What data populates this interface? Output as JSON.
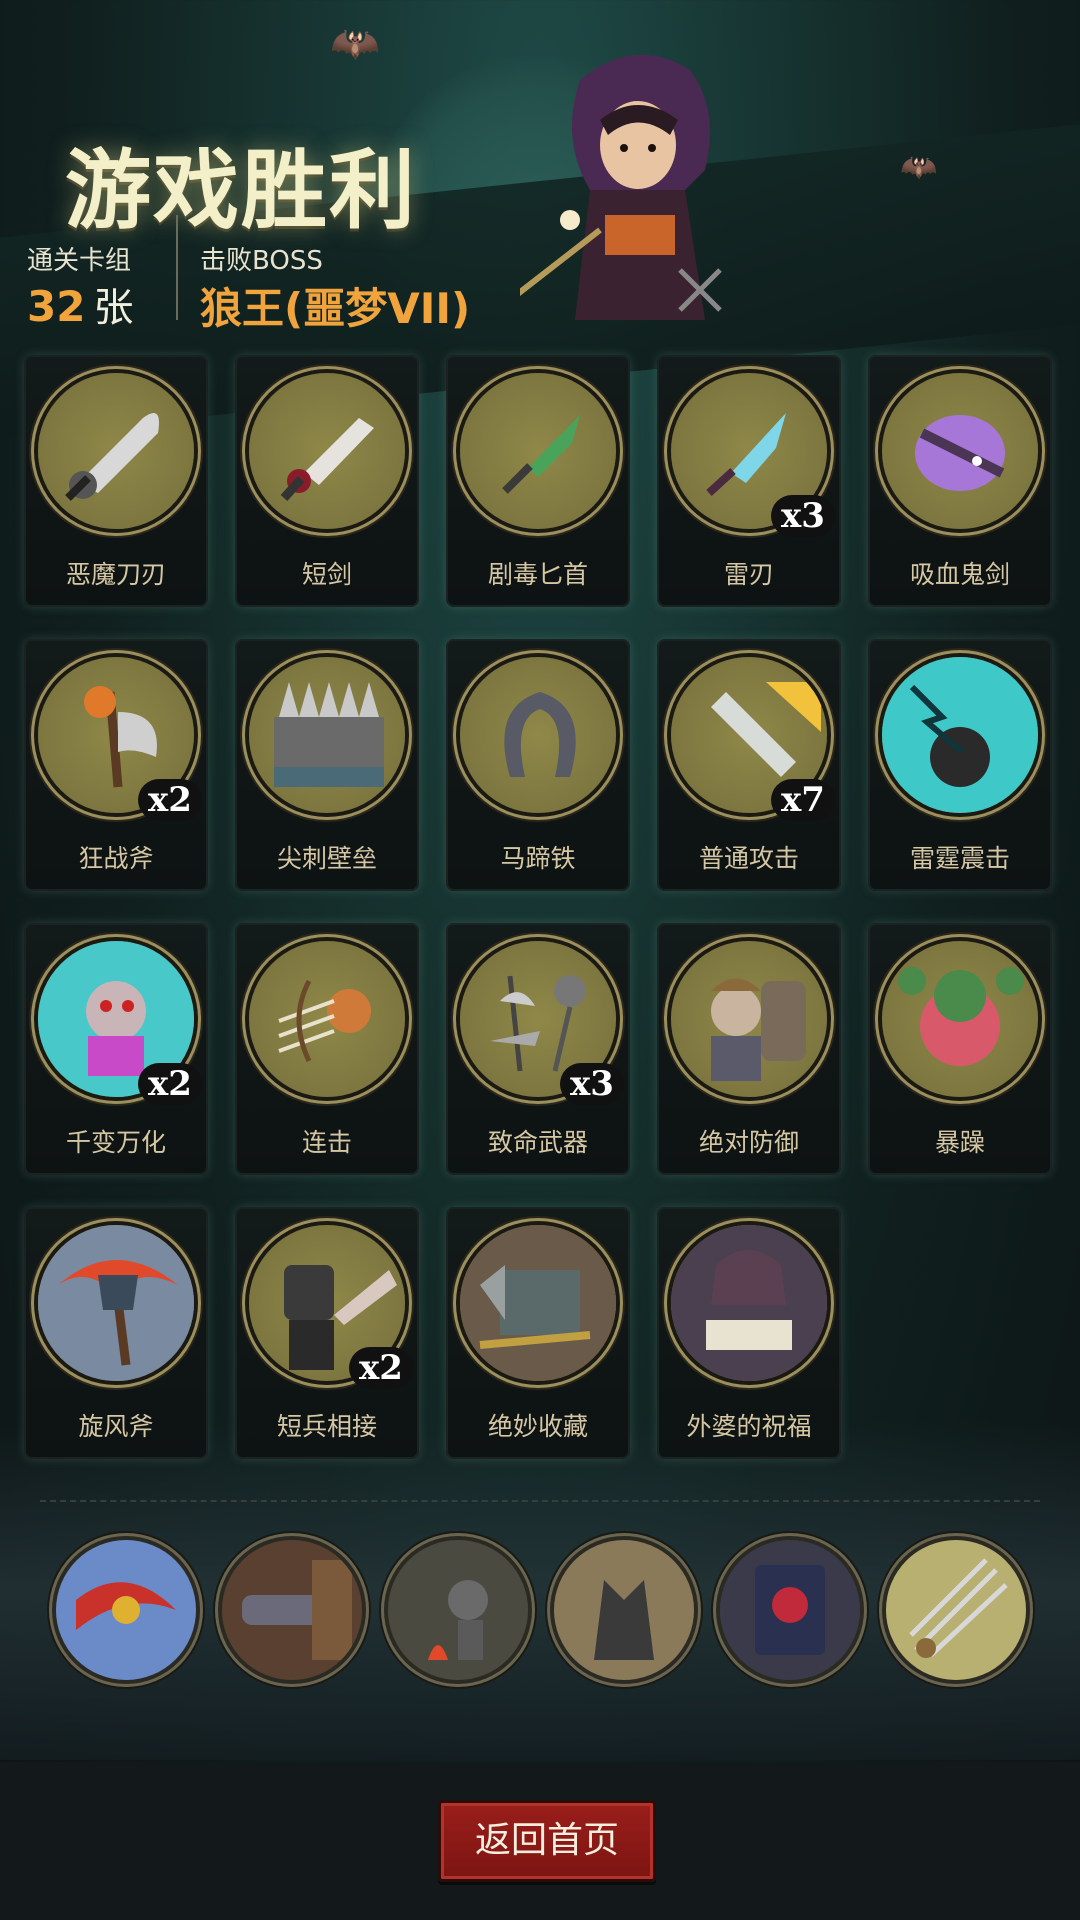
{
  "title": "游戏胜利",
  "stats": {
    "deck_label": "通关卡组",
    "deck_count": "32",
    "deck_unit": "张",
    "boss_label": "击败BOSS",
    "boss_name": "狼王(噩梦VII)"
  },
  "cards": [
    {
      "name": "恶魔刀刃",
      "count": "",
      "icon": "demon-blade-icon"
    },
    {
      "name": "短剑",
      "count": "",
      "icon": "short-sword-icon"
    },
    {
      "name": "剧毒匕首",
      "count": "",
      "icon": "poison-dagger-icon"
    },
    {
      "name": "雷刃",
      "count": "x3",
      "icon": "thunder-blade-icon"
    },
    {
      "name": "吸血鬼剑",
      "count": "",
      "icon": "vampire-sword-icon"
    },
    {
      "name": "狂战斧",
      "count": "x2",
      "icon": "berserker-axe-icon"
    },
    {
      "name": "尖刺壁垒",
      "count": "",
      "icon": "spike-barrier-icon"
    },
    {
      "name": "马蹄铁",
      "count": "",
      "icon": "horseshoe-icon"
    },
    {
      "name": "普通攻击",
      "count": "x7",
      "icon": "basic-attack-icon"
    },
    {
      "name": "雷霆震击",
      "count": "",
      "icon": "thunder-shock-icon"
    },
    {
      "name": "千变万化",
      "count": "x2",
      "icon": "ever-changing-icon"
    },
    {
      "name": "连击",
      "count": "",
      "icon": "combo-icon"
    },
    {
      "name": "致命武器",
      "count": "x3",
      "icon": "deadly-weapons-icon"
    },
    {
      "name": "绝对防御",
      "count": "",
      "icon": "absolute-defense-icon"
    },
    {
      "name": "暴躁",
      "count": "",
      "icon": "rage-icon"
    },
    {
      "name": "旋风斧",
      "count": "",
      "icon": "whirlwind-axe-icon"
    },
    {
      "name": "短兵相接",
      "count": "x2",
      "icon": "close-combat-icon"
    },
    {
      "name": "绝妙收藏",
      "count": "",
      "icon": "wonderful-collection-icon"
    },
    {
      "name": "外婆的祝福",
      "count": "",
      "icon": "grandma-blessing-icon"
    }
  ],
  "relics": [
    {
      "icon": "winged-warrior-relic-icon"
    },
    {
      "icon": "cannon-relic-icon"
    },
    {
      "icon": "campfire-relic-icon"
    },
    {
      "icon": "gargoyle-relic-icon"
    },
    {
      "icon": "red-book-relic-icon"
    },
    {
      "icon": "triple-blades-relic-icon"
    }
  ],
  "footer": {
    "home_button": "返回首页"
  },
  "colors": {
    "accent_orange": "#f2a43c",
    "button_red": "#8c1a16",
    "medallion_olive": "#847d43"
  }
}
